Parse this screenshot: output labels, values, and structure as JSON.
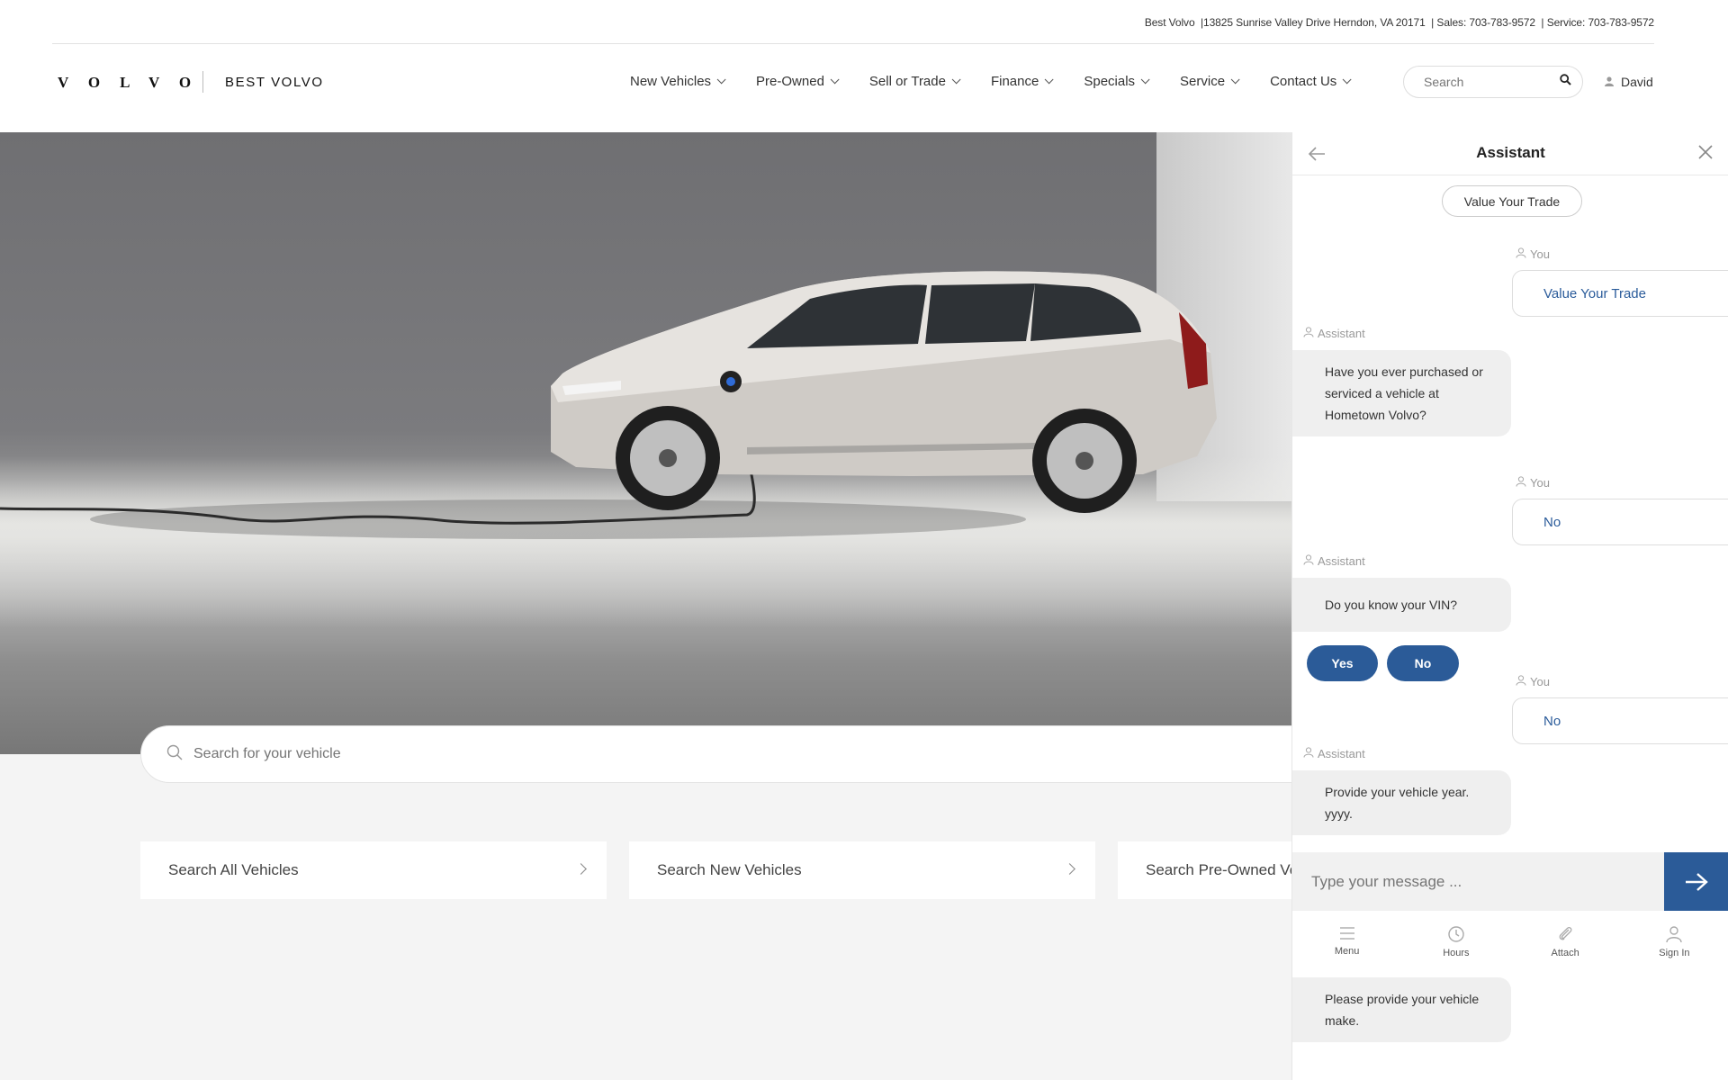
{
  "header": {
    "top_info": {
      "dealer": "Best Volvo",
      "address": "13825 Sunrise Valley Drive Herndon, VA 20171",
      "sales": "Sales: 703-783-9572",
      "service": "Service: 703-783-9572"
    },
    "logo_text": "VOLVO",
    "dealer_name": "BEST VOLVO",
    "nav": [
      {
        "label": "New Vehicles"
      },
      {
        "label": "Pre-Owned"
      },
      {
        "label": "Sell or Trade"
      },
      {
        "label": "Finance"
      },
      {
        "label": "Specials"
      },
      {
        "label": "Service"
      },
      {
        "label": "Contact Us"
      }
    ],
    "search_placeholder": "Search",
    "user_name": "David"
  },
  "hero": {
    "vehicle_search_placeholder": "Search for your vehicle"
  },
  "quick_links": [
    {
      "label": "Search All Vehicles"
    },
    {
      "label": "Search New Vehicles"
    },
    {
      "label": "Search Pre-Owned Vehicles"
    }
  ],
  "chat": {
    "title": "Assistant",
    "top_pill": "Value Your Trade",
    "you_label": "You",
    "assistant_label": "Assistant",
    "messages": [
      {
        "from": "you",
        "text": "Value Your Trade"
      },
      {
        "from": "assistant",
        "text": "Have you ever purchased or serviced a vehicle at Hometown Volvo?"
      },
      {
        "from": "you",
        "text": "No"
      },
      {
        "from": "assistant",
        "text": "Do you know your VIN?"
      },
      {
        "from": "you",
        "text": "No"
      },
      {
        "from": "assistant",
        "text": "Provide your vehicle year. yyyy."
      },
      {
        "from": "assistant",
        "text": "Please provide your vehicle make."
      }
    ],
    "quick_replies": [
      "Yes",
      "No"
    ],
    "composer_placeholder": "Type your message ...",
    "toolbar": [
      {
        "label": "Menu",
        "icon": "menu-icon"
      },
      {
        "label": "Hours",
        "icon": "clock-icon"
      },
      {
        "label": "Attach",
        "icon": "paperclip-icon"
      },
      {
        "label": "Sign In",
        "icon": "user-icon"
      }
    ],
    "accent_color": "#2b5b98"
  }
}
